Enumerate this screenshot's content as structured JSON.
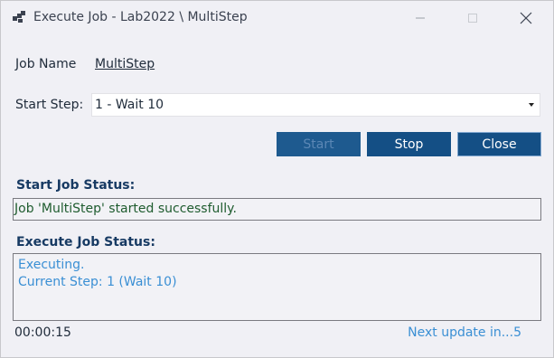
{
  "window": {
    "title": "Execute Job - Lab2022 \\ MultiStep",
    "icons": {
      "app": "app-icon",
      "minimize": "minimize-icon",
      "maximize": "maximize-icon",
      "close": "close-icon"
    }
  },
  "job": {
    "label": "Job Name",
    "name": "MultiStep"
  },
  "start_step": {
    "label": "Start Step:",
    "selected": "1 - Wait 10"
  },
  "buttons": {
    "start": "Start",
    "stop": "Stop",
    "close": "Close"
  },
  "start_job_status": {
    "heading": "Start Job Status:",
    "message": "Job 'MultiStep' started successfully."
  },
  "execute_job_status": {
    "heading": "Execute Job Status:",
    "lines": [
      "Executing.",
      "Current Step: 1 (Wait 10)"
    ]
  },
  "footer": {
    "elapsed": "00:00:15",
    "next_update": "Next update in...5"
  },
  "colors": {
    "button": "#144f85",
    "status_blue": "#3a8fd4",
    "success_green": "#1f5c2f"
  }
}
